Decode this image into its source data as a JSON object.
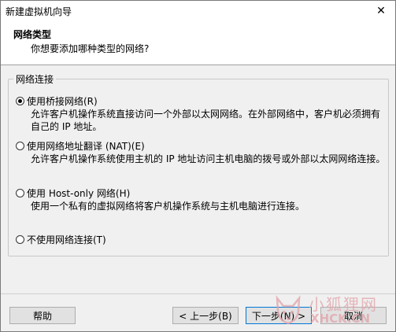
{
  "window": {
    "title": "新建虚拟机向导",
    "close_label": "✕"
  },
  "header": {
    "title": "网络类型",
    "subtitle": "你想要添加哪种类型的网络?"
  },
  "group": {
    "legend": "网络连接",
    "options": [
      {
        "label": "使用桥接网络(R)",
        "description": "允许客户机操作系统直接访问一个外部以太网网络。在外部网络中，客户机必须拥有自己的 IP 地址。",
        "checked": true
      },
      {
        "label": "使用网络地址翻译 (NAT)(E)",
        "description": "允许客户机操作系统使用主机的 IP 地址访问主机电脑的拨号或外部以太网网络连接。",
        "checked": false
      },
      {
        "label": "使用 Host-only 网络(H)",
        "description": "使用一个私有的虚拟网络将客户机操作系统与主机电脑进行连接。",
        "checked": false
      },
      {
        "label": "不使用网络连接(T)",
        "description": "",
        "checked": false
      }
    ]
  },
  "buttons": {
    "help": "帮助",
    "back": "< 上一步(B)",
    "next": "下一步(N) >",
    "cancel": "取消"
  },
  "watermark": {
    "cn": "小狐狸网",
    "en": "XHCK.CN"
  },
  "colors": {
    "focus_border": "#0078d7",
    "watermark": "#e0a3a9"
  }
}
